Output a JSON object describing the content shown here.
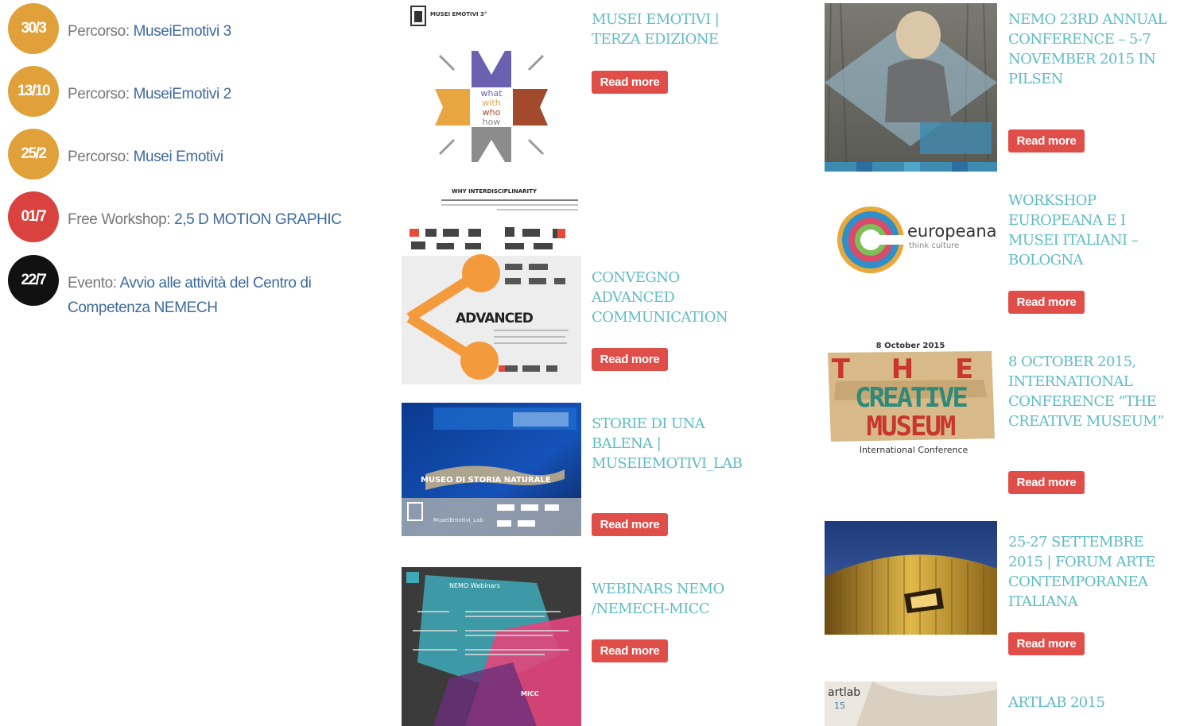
{
  "events": [
    {
      "date": "30/3",
      "color": "#e0a03a",
      "prefix": "Percorso: ",
      "link": "MuseiEmotivi 3"
    },
    {
      "date": "13/10",
      "color": "#e0a03a",
      "prefix": "Percorso: ",
      "link": "MuseiEmotivi 2"
    },
    {
      "date": "25/2",
      "color": "#e0a03a",
      "prefix": "Percorso: ",
      "link": "Musei Emotivi"
    },
    {
      "date": "01/7",
      "color": "#d9423f",
      "prefix": "Free Workshop: ",
      "link": "2,5 D MOTION GRAPHIC"
    },
    {
      "date": "22/7",
      "color": "#111111",
      "prefix": "Evento: ",
      "link": "Avvio alle attività del Centro di Competenza NEMECH"
    }
  ],
  "read_more_label": "Read more",
  "news_middle": [
    {
      "title": "MUSEI EMOTIVI | TERZA EDIZIONE",
      "image_text": [
        "MUSEI EMOTIVI 3°",
        "what",
        "with",
        "who",
        "how"
      ]
    },
    {
      "title": "CONVEGNO ADVANCED COMMUNICATION",
      "image_text": [
        "WHY INTERDISCIPLINARITY",
        "ADVANCED"
      ]
    },
    {
      "title": "STORIE DI UNA BALENA | MUSEIEMOTIVI_LAB",
      "image_text": [
        "MUSEO DI STORIA NATURALE",
        "MuseiEmotivi_Lab"
      ]
    },
    {
      "title": "WEBINARS NEMO /NEMECH-MICC",
      "image_text": [
        "NEMO Webinars",
        "MICC"
      ]
    }
  ],
  "news_right": [
    {
      "title": "NEMO 23RD ANNUAL CONFERENCE – 5-7 NOVEMBER 2015 IN PILSEN",
      "image_text": []
    },
    {
      "title": "WORKSHOP EUROPEANA E I MUSEI ITALIANI – BOLOGNA",
      "image_text": [
        "europeana",
        "think culture"
      ]
    },
    {
      "title": "8 OCTOBER 2015, INTERNATIONAL CONFERENCE “THE CREATIVE MUSEUM”",
      "image_text": [
        "8 October 2015",
        "T H E",
        "CREATIVE",
        "MUSEUM",
        "International Conference"
      ]
    },
    {
      "title": "25-27 SETTEMBRE 2015 | FORUM ARTE CONTEMPORANEA ITALIANA",
      "image_text": []
    },
    {
      "title": "ARTLAB 2015",
      "image_text": [
        "artlab",
        "15"
      ]
    }
  ],
  "colors": {
    "title": "#5fbcc4",
    "read_more": "#e04e4a",
    "link": "#3e6a9c"
  }
}
